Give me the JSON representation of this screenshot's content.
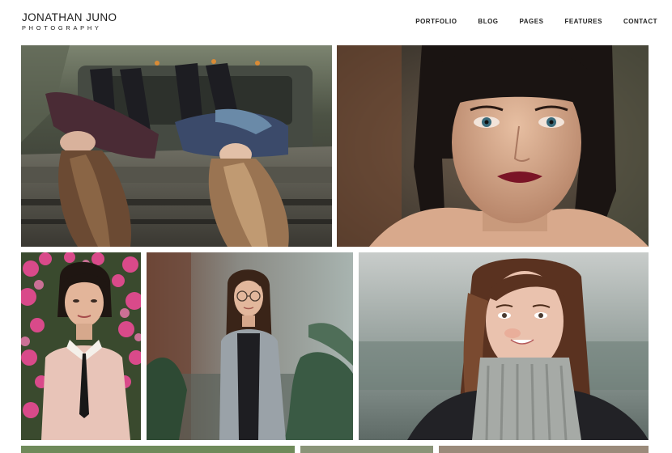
{
  "site": {
    "logo_title": "JONATHAN JUNO",
    "logo_subtitle": "PHOTOGRAPHY"
  },
  "nav": {
    "items": [
      {
        "label": "PORTFOLIO"
      },
      {
        "label": "BLOG"
      },
      {
        "label": "PAGES"
      },
      {
        "label": "FEATURES"
      },
      {
        "label": "CONTACT"
      }
    ]
  },
  "gallery": {
    "photos": [
      {
        "subject": "two-women-on-truck-hood"
      },
      {
        "subject": "woman-red-lips-bangs"
      },
      {
        "subject": "woman-pink-flowers"
      },
      {
        "subject": "woman-glasses-cardigan"
      },
      {
        "subject": "woman-grey-turtleneck"
      }
    ]
  },
  "colors": {
    "text": "#1b1b1b",
    "background": "#ffffff"
  }
}
